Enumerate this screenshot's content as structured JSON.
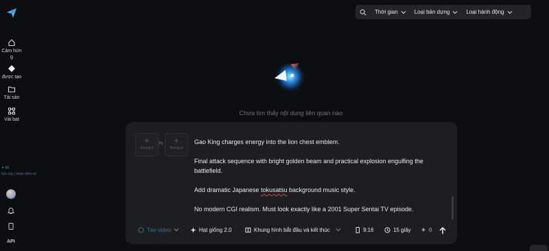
{
  "sidebar": {
    "logo_icon": "paper-plane-logo-icon",
    "items": [
      {
        "label": "Cảm hứn\ng",
        "icon": "home-icon"
      },
      {
        "label": "được tạo",
        "icon": "diamond-icon"
      },
      {
        "label": "Tài sản",
        "icon": "folder-icon"
      },
      {
        "label": "Vải bạt",
        "icon": "canvas-nodes-icon"
      }
    ],
    "credits_amount": "✦ 66",
    "credits_note": "tích này | nhận điểm trị",
    "api_label": "API"
  },
  "topbar": {
    "search_icon": "search-icon",
    "filters": [
      {
        "label": "Thời gian"
      },
      {
        "label": "Loại bản dựng"
      },
      {
        "label": "Loại hành động"
      }
    ]
  },
  "empty_state": {
    "text": "Chưa tìm thấy nội dung liên quan nào"
  },
  "composer": {
    "start_frame_label": "Khung b",
    "end_frame_label": "Khung d",
    "prompt_paragraphs": [
      "Gao King charges energy into the lion chest emblem.",
      "Final attack sequence with bright golden beam and practical explosion engulfing the battlefield.",
      "Add dramatic Japanese tokusatsu background music style.",
      "No modern CGI realism. Must look exactly like a 2001 Super Sentai TV episode."
    ],
    "toolbar": {
      "type_label": "Tạo video",
      "seed_label": "Hạt giống 2.0",
      "frame_label": "Khung hình bắt đầu và kết thúc",
      "ratio_label": "9:16",
      "duration_label": "15 giây",
      "cost_label": "0"
    }
  },
  "colors": {
    "background": "#0d0e11",
    "card": "#1d1e22",
    "accent": "#4e8fd6"
  }
}
